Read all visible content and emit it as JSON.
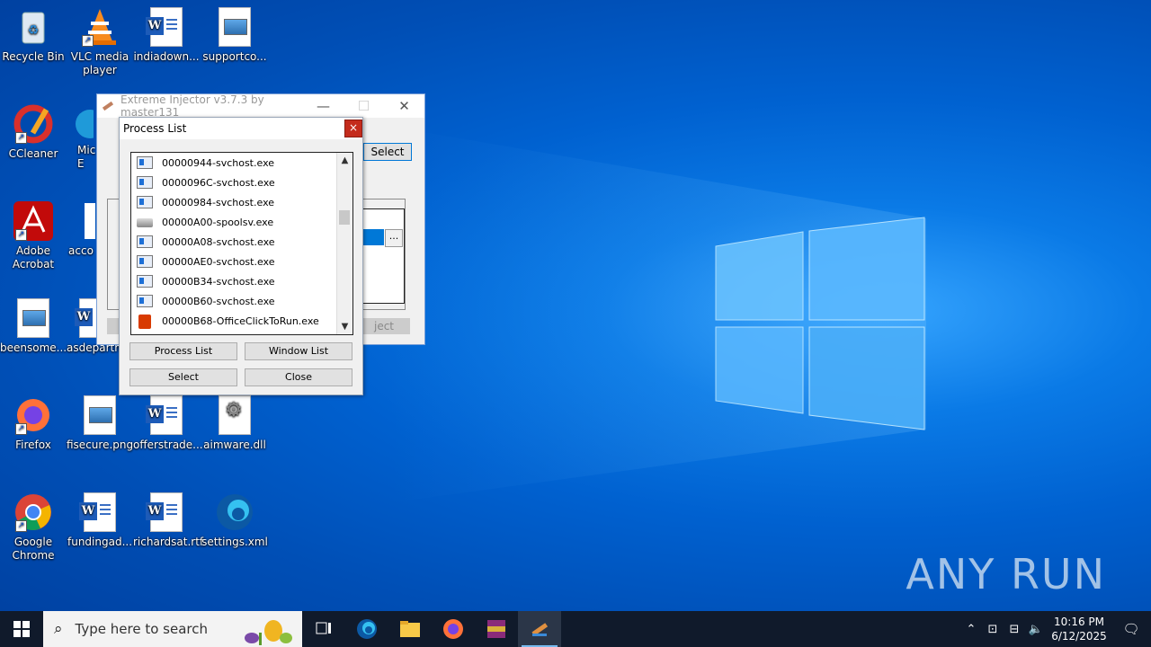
{
  "desktop": {
    "icons": [
      {
        "label": "Recycle Bin"
      },
      {
        "label": "VLC media player"
      },
      {
        "label": "indiadown..."
      },
      {
        "label": "supportco..."
      },
      {
        "label": "CCleaner"
      },
      {
        "label": "Mic E"
      },
      {
        "label": "Adobe Acrobat"
      },
      {
        "label": "acco"
      },
      {
        "label": "beensome..."
      },
      {
        "label": "asdepartm"
      },
      {
        "label": "Firefox"
      },
      {
        "label": "fisecure.png"
      },
      {
        "label": "offerstrade..."
      },
      {
        "label": "aimware.dll"
      },
      {
        "label": "Google Chrome"
      },
      {
        "label": "fundingad..."
      },
      {
        "label": "richardsat.rtf"
      },
      {
        "label": "settings.xml"
      }
    ]
  },
  "injector": {
    "title": "Extreme Injector v3.7.3 by master131",
    "select_label": "Select",
    "dots_label": "...",
    "inject_label": "ject"
  },
  "process_list": {
    "title": "Process List",
    "close_glyph": "×",
    "processes": [
      {
        "name": "00000944-svchost.exe",
        "icon": "window"
      },
      {
        "name": "0000096C-svchost.exe",
        "icon": "window"
      },
      {
        "name": "00000984-svchost.exe",
        "icon": "window"
      },
      {
        "name": "00000A00-spoolsv.exe",
        "icon": "printer"
      },
      {
        "name": "00000A08-svchost.exe",
        "icon": "window"
      },
      {
        "name": "00000AE0-svchost.exe",
        "icon": "window"
      },
      {
        "name": "00000B34-svchost.exe",
        "icon": "window"
      },
      {
        "name": "00000B60-svchost.exe",
        "icon": "window"
      },
      {
        "name": "00000B68-OfficeClickToRun.exe",
        "icon": "office"
      }
    ],
    "buttons": {
      "process_list": "Process List",
      "window_list": "Window List",
      "select": "Select",
      "close": "Close"
    }
  },
  "taskbar": {
    "search_placeholder": "Type here to search",
    "time": "10:16 PM",
    "date": "6/12/2025"
  },
  "watermark": "ANY RUN"
}
